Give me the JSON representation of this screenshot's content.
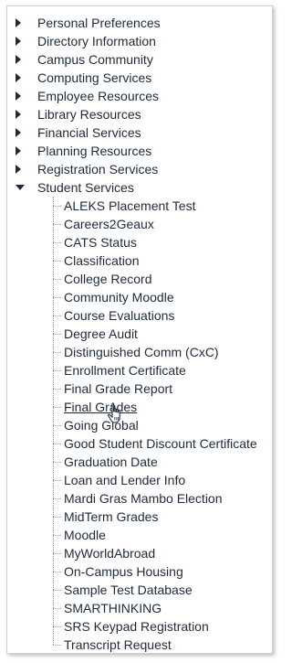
{
  "categories": [
    {
      "label": "Personal Preferences",
      "expanded": false
    },
    {
      "label": "Directory Information",
      "expanded": false
    },
    {
      "label": "Campus Community",
      "expanded": false
    },
    {
      "label": "Computing Services",
      "expanded": false
    },
    {
      "label": "Employee Resources",
      "expanded": false
    },
    {
      "label": "Library Resources",
      "expanded": false
    },
    {
      "label": "Financial Services",
      "expanded": false
    },
    {
      "label": "Planning Resources",
      "expanded": false
    },
    {
      "label": "Registration Services",
      "expanded": false
    },
    {
      "label": "Student Services",
      "expanded": true
    }
  ],
  "student_services": [
    "ALEKS Placement Test",
    "Careers2Geaux",
    "CATS Status",
    "Classification",
    "College Record",
    "Community Moodle",
    "Course Evaluations",
    "Degree Audit",
    "Distinguished Comm (CxC)",
    "Enrollment Certificate",
    "Final Grade Report",
    "Final Grades",
    "Going Global",
    "Good Student Discount Certificate",
    "Graduation Date",
    "Loan and Lender Info",
    "Mardi Gras Mambo Election",
    "MidTerm Grades",
    "Moodle",
    "MyWorldAbroad",
    "On-Campus Housing",
    "Sample Test Database",
    "SMARTHINKING",
    "SRS Keypad Registration",
    "Transcript Request"
  ],
  "hovered_item": "Final Grades",
  "colors": {
    "text": "#1e2a3a",
    "border": "#d0d0d0",
    "tree_line": "#9a9a9a"
  }
}
